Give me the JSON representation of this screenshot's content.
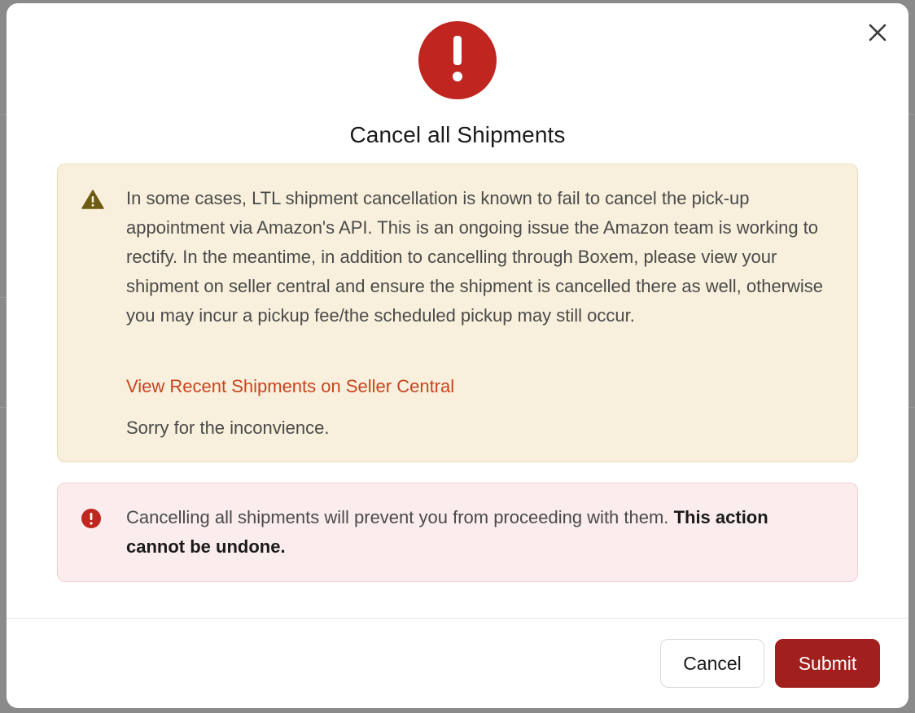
{
  "modal": {
    "title": "Cancel all Shipments",
    "close_icon": "close-icon",
    "hero_icon": "exclamation-circle-icon",
    "colors": {
      "danger": "#c0261f",
      "submit": "#a11f1d",
      "link": "#c8441f",
      "warning_bg": "#f8f0dc",
      "error_bg": "#fbeced"
    }
  },
  "warning": {
    "icon": "warning-triangle-icon",
    "text": "In some cases, LTL shipment cancellation is known to fail to cancel the pick-up appointment via Amazon's API. This is an ongoing issue the Amazon team is working to rectify. In the meantime, in addition to cancelling through Boxem, please view your shipment on seller central and ensure the shipment is cancelled there as well, otherwise you may incur a pickup fee/the scheduled pickup may still occur.",
    "link_label": "View Recent Shipments on Seller Central",
    "apology": "Sorry for the inconvience."
  },
  "error": {
    "icon": "error-circle-icon",
    "text": "Cancelling all shipments will prevent you from proceeding with them.",
    "emphasis": "This action cannot be undone."
  },
  "footer": {
    "cancel_label": "Cancel",
    "submit_label": "Submit"
  }
}
